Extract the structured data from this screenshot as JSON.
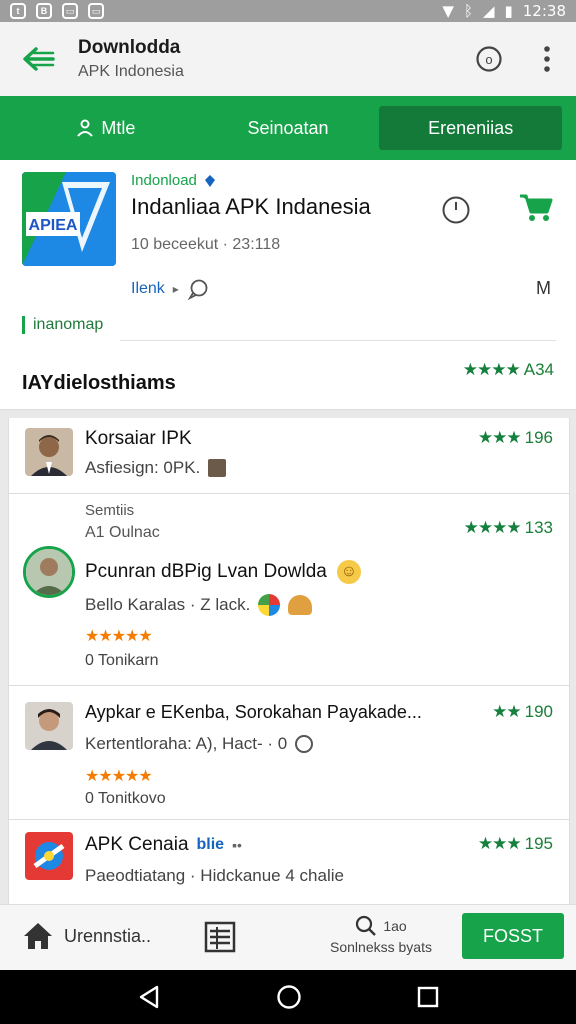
{
  "status_bar": {
    "time": "12:38"
  },
  "app_bar": {
    "title": "Downlodda",
    "subtitle": "APK Indonesia"
  },
  "tabs": [
    {
      "label": "Mtle"
    },
    {
      "label": "Seinoatan"
    },
    {
      "label": "Ereneniias"
    }
  ],
  "featured": {
    "logo_text": "APIEA",
    "developer": "Indonload",
    "name": "Indanliaa APK Indanesia",
    "meta": "10 beceekut · 23:118",
    "link": "Ilenk",
    "badge": "M",
    "tag": "inanomap",
    "section_title": "IAYdielosthiams",
    "section_rating": "A34"
  },
  "reviews": [
    {
      "name": "Korsaiar IPK",
      "sub": "Asfiesign: 0PK.",
      "rating": "196"
    },
    {
      "label1": "Semtiis",
      "label2": "A1 Oulnac",
      "name": "Pcunran dBPig Lvan Dowlda",
      "sub": "Bello Karalas · Z lack.",
      "footer": "0 Tonikarn",
      "rating": "133"
    },
    {
      "name": "Aypkar e EKenba, Sorokahan Payakade...",
      "sub": "Kertentloraha: A), Hact- · 0",
      "footer": "0 Tonitkovo",
      "rating": "190"
    },
    {
      "name": "APK Cenaia",
      "name_tag": "blie",
      "sub": "Paeodtiatang · Hidckanue 4 chalie",
      "rating": "195"
    }
  ],
  "bottom_bar": {
    "home_label": "Urennstia..",
    "search_top": "1ao",
    "search_label": "Sonlnekss byats",
    "button": "FOSST"
  },
  "colors": {
    "accent": "#16a34a",
    "accent_dark": "#137a3a",
    "star_green": "#15803d",
    "star_orange": "#f57c00"
  }
}
